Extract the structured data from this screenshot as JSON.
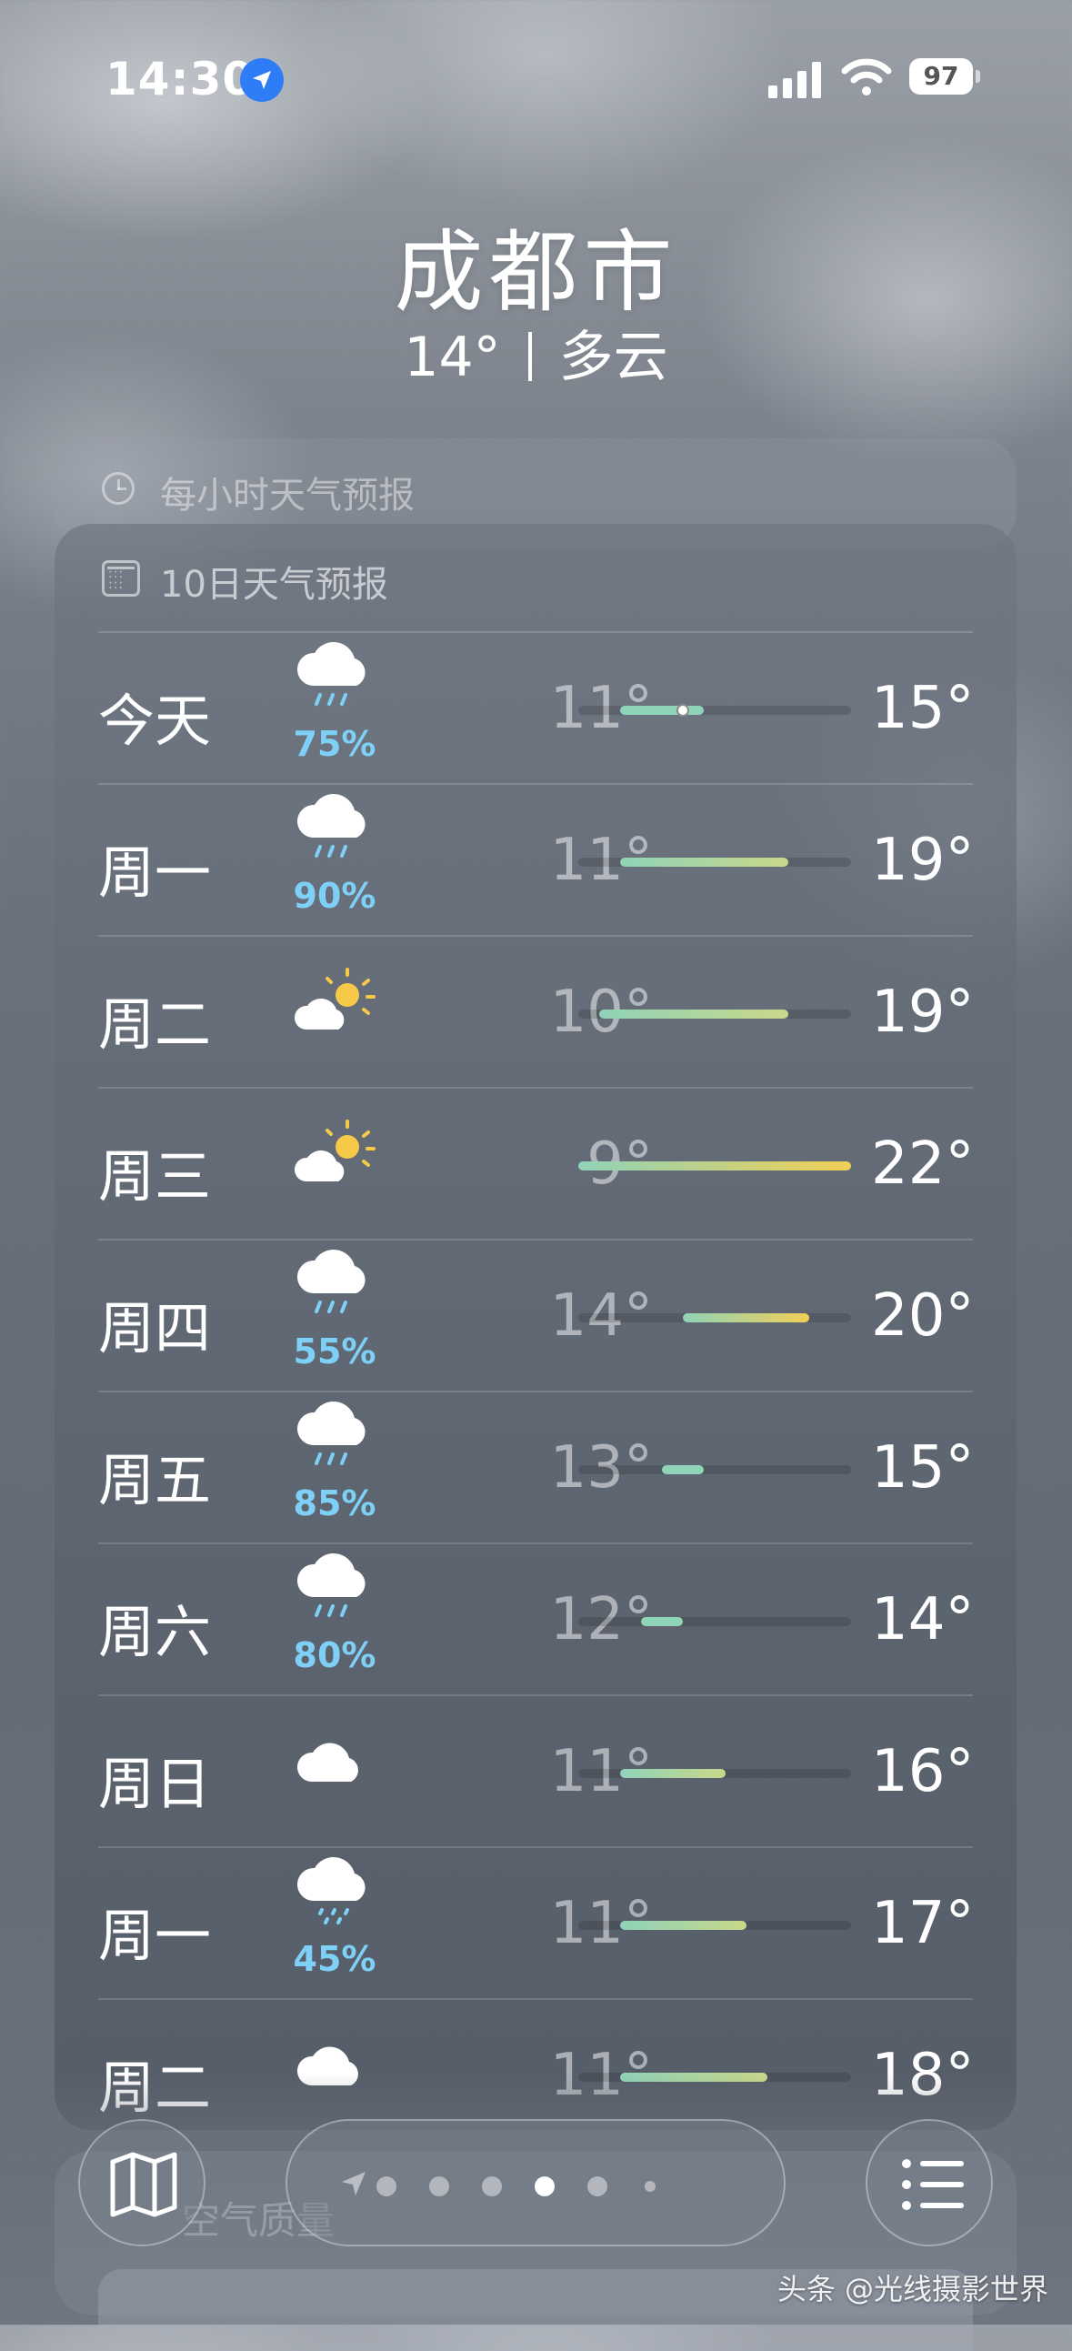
{
  "status_bar": {
    "time": "14:30",
    "battery": "97",
    "location_icon": "location-arrow-icon",
    "signal_icon": "cellular-signal-icon",
    "wifi_icon": "wifi-icon"
  },
  "location": {
    "city": "成都市",
    "temperature": "14°",
    "condition": "多云"
  },
  "hourly": {
    "title": "每小时天气预报",
    "icon": "clock-icon"
  },
  "forecast": {
    "title": "10日天气预报",
    "icon": "calendar-icon",
    "days": [
      {
        "day": "今天",
        "icon": "cloud-rain-icon",
        "precip": "75%",
        "low": "11°",
        "high": "15°",
        "range": [
          11,
          15
        ],
        "current": 14
      },
      {
        "day": "周一",
        "icon": "cloud-rain-icon",
        "precip": "90%",
        "low": "11°",
        "high": "19°",
        "range": [
          11,
          19
        ]
      },
      {
        "day": "周二",
        "icon": "cloud-sun-icon",
        "precip": "",
        "low": "10°",
        "high": "19°",
        "range": [
          10,
          19
        ]
      },
      {
        "day": "周三",
        "icon": "cloud-sun-icon",
        "precip": "",
        "low": "9°",
        "high": "22°",
        "range": [
          9,
          22
        ]
      },
      {
        "day": "周四",
        "icon": "cloud-rain-icon",
        "precip": "55%",
        "low": "14°",
        "high": "20°",
        "range": [
          14,
          20
        ]
      },
      {
        "day": "周五",
        "icon": "cloud-rain-icon",
        "precip": "85%",
        "low": "13°",
        "high": "15°",
        "range": [
          13,
          15
        ]
      },
      {
        "day": "周六",
        "icon": "cloud-rain-icon",
        "precip": "80%",
        "low": "12°",
        "high": "14°",
        "range": [
          12,
          14
        ]
      },
      {
        "day": "周日",
        "icon": "cloud-icon",
        "precip": "",
        "low": "11°",
        "high": "16°",
        "range": [
          11,
          16
        ]
      },
      {
        "day": "周一",
        "icon": "cloud-drizzle-icon",
        "precip": "45%",
        "low": "11°",
        "high": "17°",
        "range": [
          11,
          17
        ]
      },
      {
        "day": "周二",
        "icon": "cloud-icon",
        "precip": "",
        "low": "11°",
        "high": "18°",
        "range": [
          11,
          18
        ]
      }
    ],
    "scale": [
      9,
      22
    ]
  },
  "air_quality": {
    "title": "空气质量"
  },
  "toolbar": {
    "map_icon": "map-icon",
    "list_icon": "list-icon",
    "page_count": 7,
    "active_page": 5
  },
  "watermark": "头条 @光线摄影世界"
}
